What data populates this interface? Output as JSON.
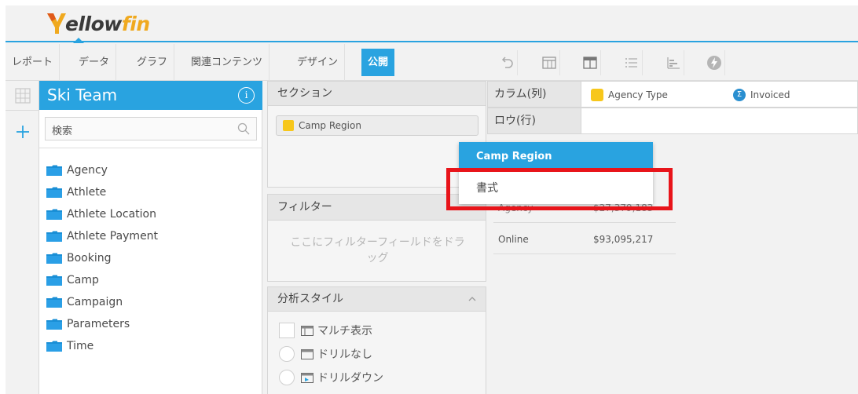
{
  "brand": {
    "logo_part1": "ellow",
    "logo_part2": "fin",
    "accent": "#29a3e0",
    "logo_yellow": "#f0a91e"
  },
  "menu": {
    "items": [
      {
        "label": "レポート"
      },
      {
        "label": "データ"
      },
      {
        "label": "グラフ"
      },
      {
        "label": "関連コンテンツ"
      },
      {
        "label": "デザイン"
      },
      {
        "label": "公開",
        "active": true
      }
    ],
    "tools": [
      "undo-icon",
      "table-icon",
      "layout-icon",
      "list-icon",
      "chart-icon",
      "lightning-icon"
    ]
  },
  "leftstrip": {
    "icons": [
      "grid-icon",
      "add-icon"
    ]
  },
  "sidebar": {
    "title": "Ski Team",
    "search_placeholder": "検索",
    "folders": [
      {
        "label": "Agency"
      },
      {
        "label": "Athlete"
      },
      {
        "label": "Athlete Location"
      },
      {
        "label": "Athlete Payment"
      },
      {
        "label": "Booking"
      },
      {
        "label": "Camp"
      },
      {
        "label": "Campaign"
      },
      {
        "label": "Parameters"
      },
      {
        "label": "Time"
      }
    ]
  },
  "middle": {
    "section_header": "セクション",
    "section_field": "Camp Region",
    "filter_header": "フィルター",
    "filter_hint_line1": "ここにフィルターフィールドをドラ",
    "filter_hint_line2": "ッグ",
    "analysis_header": "分析スタイル",
    "styles": [
      {
        "label": "マルチ表示"
      },
      {
        "label": "ドリルなし"
      },
      {
        "label": "ドリルダウン"
      }
    ]
  },
  "right": {
    "columns_label": "カラム(列)",
    "rows_label": "ロウ(行)",
    "column_fields": [
      {
        "label": "Agency Type",
        "icon": "dimension-icon"
      },
      {
        "label": "Invoiced",
        "icon": "sigma-icon"
      }
    ],
    "table": {
      "rows": [
        {
          "label": "Agency",
          "value": "$27,379,183"
        },
        {
          "label": "Online",
          "value": "$93,095,217"
        }
      ]
    }
  },
  "context_menu": {
    "header": "Camp Region",
    "item": "書式",
    "highlight_color": "#e8141a"
  }
}
